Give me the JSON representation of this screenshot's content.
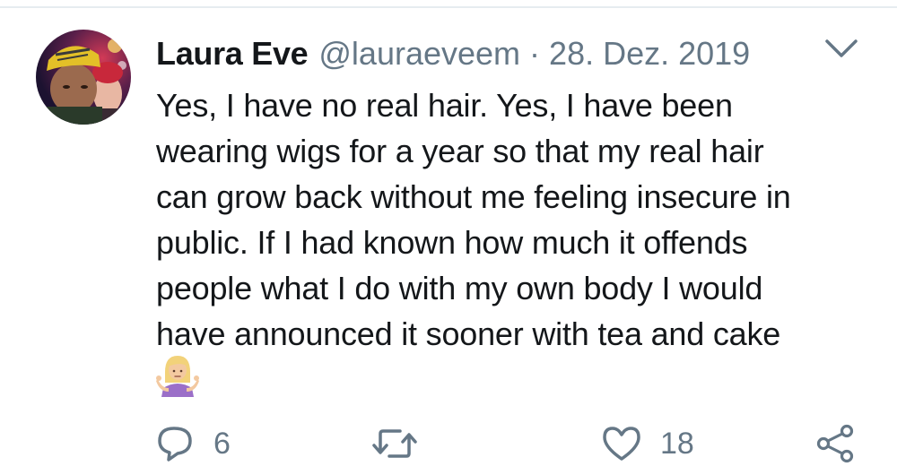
{
  "tweet": {
    "author_name": "Laura Eve",
    "handle": "@lauraeveem",
    "separator": "·",
    "date": "28. Dez. 2019",
    "lines": [
      "Yes, I have no real hair. Yes, I have been",
      "wearing wigs for a year so that my real hair",
      "can grow back without me feeling insecure in",
      "public. If I had known how much it offends",
      "people what I do with my own body I would",
      "have announced it sooner with tea and cake"
    ],
    "emoji": "person-shrugging-emoji"
  },
  "actions": {
    "reply_count": "6",
    "retweet_count": "",
    "like_count": "18"
  },
  "icons": {
    "menu": "chevron-down-icon",
    "reply": "reply-icon",
    "retweet": "retweet-icon",
    "like": "heart-icon",
    "share": "share-icon"
  },
  "colors": {
    "text": "#14171a",
    "secondary": "#657786",
    "divider": "#e6ecf0"
  }
}
